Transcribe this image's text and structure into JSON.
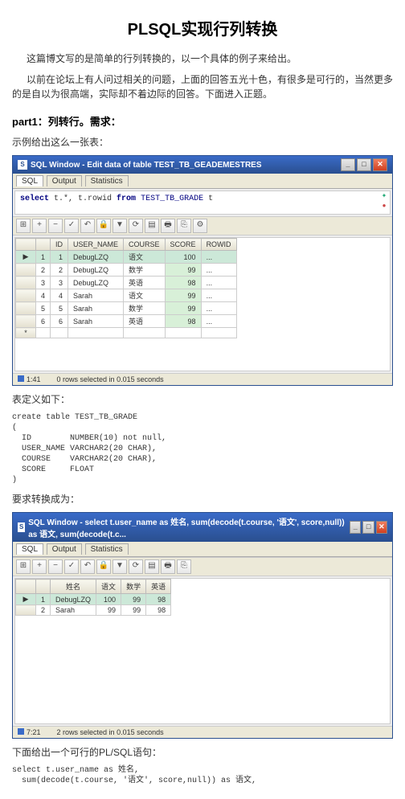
{
  "title": "PLSQL实现行列转换",
  "intro1": "这篇博文写的是简单的行列转换的，以一个具体的例子来给出。",
  "intro2": "以前在论坛上有人问过相关的问题，上面的回答五光十色，有很多是可行的，当然更多的是自以为很高端，实际却不着边际的回答。下面进入正题。",
  "part1_heading": "part1：列转行。需求：",
  "note1": "示例给出这么一张表：",
  "win1": {
    "title": "SQL Window - Edit data of table TEST_TB_GEADEMESTRES",
    "tabs": {
      "sql": "SQL",
      "output": "Output",
      "stat": "Statistics"
    },
    "sql": {
      "full": "select t.*, t.rowid from TEST_TB_GRADE t"
    },
    "cols": [
      "ID",
      "USER_NAME",
      "COURSE",
      "SCORE",
      "ROWID"
    ],
    "rows": [
      {
        "n": "1",
        "id": "1",
        "user": "DebugLZQ",
        "course": "语文",
        "score": "100",
        "rowid": "..."
      },
      {
        "n": "2",
        "id": "2",
        "user": "DebugLZQ",
        "course": "数学",
        "score": "99",
        "rowid": "..."
      },
      {
        "n": "3",
        "id": "3",
        "user": "DebugLZQ",
        "course": "英语",
        "score": "98",
        "rowid": "..."
      },
      {
        "n": "4",
        "id": "4",
        "user": "Sarah",
        "course": "语文",
        "score": "99",
        "rowid": "..."
      },
      {
        "n": "5",
        "id": "5",
        "user": "Sarah",
        "course": "数学",
        "score": "99",
        "rowid": "..."
      },
      {
        "n": "6",
        "id": "6",
        "user": "Sarah",
        "course": "英语",
        "score": "98",
        "rowid": "..."
      }
    ],
    "status_pos": "1:41",
    "status_msg": "0 rows selected in 0.015 seconds"
  },
  "note2": "表定义如下：",
  "ddl": "create table TEST_TB_GRADE\n(\n  ID        NUMBER(10) not null,\n  USER_NAME VARCHAR2(20 CHAR),\n  COURSE    VARCHAR2(20 CHAR),\n  SCORE     FLOAT\n)",
  "note3": "要求转换成为：",
  "win2": {
    "title": "SQL Window - select t.user_name as 姓名, sum(decode(t.course, '语文', score,null)) as 语文, sum(decode(t.c...",
    "tabs": {
      "sql": "SQL",
      "output": "Output",
      "stat": "Statistics"
    },
    "cols": [
      "姓名",
      "语文",
      "数学",
      "英语"
    ],
    "rows": [
      {
        "n": "1",
        "name": "DebugLZQ",
        "c1": "100",
        "c2": "99",
        "c3": "98"
      },
      {
        "n": "2",
        "name": "Sarah",
        "c1": "99",
        "c2": "99",
        "c3": "98"
      }
    ],
    "status_pos": "7:21",
    "status_msg": "2 rows selected in 0.015 seconds"
  },
  "note4": "下面给出一个可行的PL/SQL语句：",
  "sql_final": "select t.user_name as 姓名,\n  sum(decode(t.course, '语文', score,null)) as 语文,"
}
